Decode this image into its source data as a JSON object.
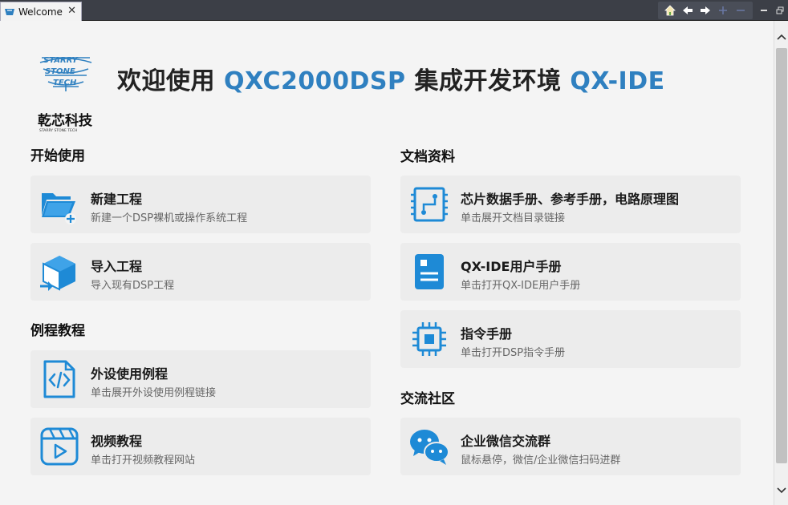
{
  "tab": {
    "label": "Welcome",
    "close": "✕"
  },
  "header": {
    "logo_text": "乾芯科技",
    "logo_wordmark": "STARRY STONE TECH",
    "title_prefix": "欢迎使用 ",
    "title_accent1": "QXC2000DSP",
    "title_middle": " 集成开发环境 ",
    "title_accent2": "QX-IDE"
  },
  "colors": {
    "accent": "#2f80c0",
    "icon": "#1e8ad6",
    "card_bg": "#ececec",
    "page_bg": "#f4f4f4"
  },
  "sections": {
    "start": "开始使用",
    "examples": "例程教程",
    "docs": "文档资料",
    "community": "交流社区"
  },
  "cards": {
    "new_project": {
      "title": "新建工程",
      "sub": "新建一个DSP裸机或操作系统工程",
      "icon": "folder-add-icon"
    },
    "import_project": {
      "title": "导入工程",
      "sub": "导入现有DSP工程",
      "icon": "box-import-icon"
    },
    "peripheral_examples": {
      "title": "外设使用例程",
      "sub": "单击展开外设使用例程链接",
      "icon": "code-file-icon"
    },
    "video_tutorials": {
      "title": "视频教程",
      "sub": "单击打开视频教程网站",
      "icon": "video-play-icon"
    },
    "chip_docs": {
      "title": "芯片数据手册、参考手册，电路原理图",
      "sub": "单击展开文档目录链接",
      "icon": "circuit-board-icon"
    },
    "user_manual": {
      "title": "QX-IDE用户手册",
      "sub": "单击打开QX-IDE用户手册",
      "icon": "manual-icon"
    },
    "instruction_manual": {
      "title": "指令手册",
      "sub": "单击打开DSP指令手册",
      "icon": "chip-icon"
    },
    "wechat_group": {
      "title": "企业微信交流群",
      "sub": "鼠标悬停，微信/企业微信扫码进群",
      "icon": "wechat-icon"
    }
  }
}
